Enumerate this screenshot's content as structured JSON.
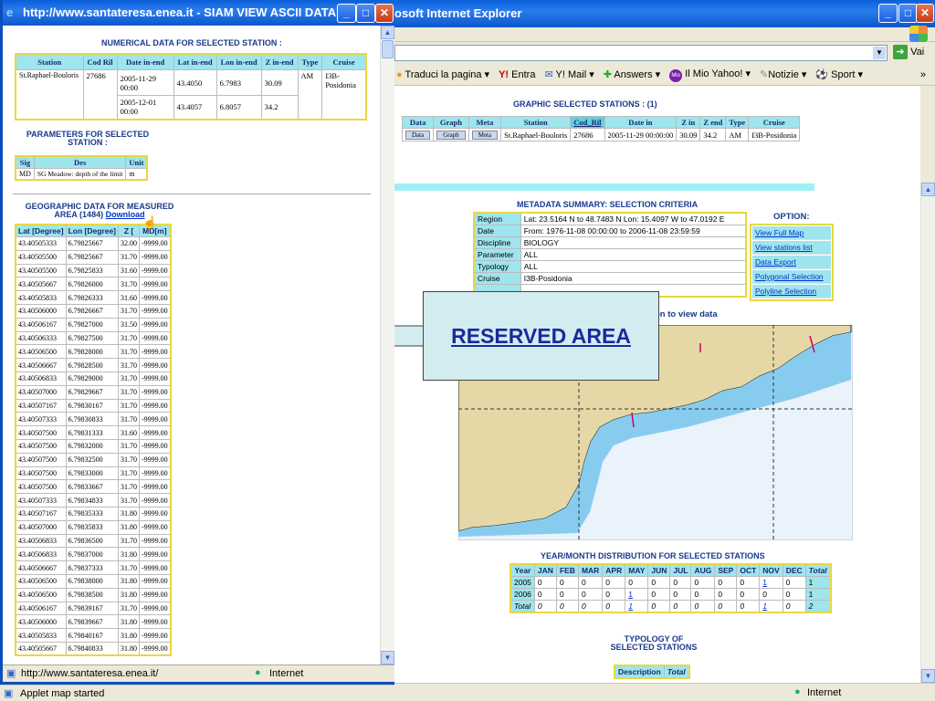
{
  "back_window": {
    "title": "osoft Internet Explorer",
    "address_go": "Vai",
    "links": [
      {
        "icon": "translate-icon",
        "label": "Traduci la pagina"
      },
      {
        "icon": "yahoo-icon",
        "label": "Entra"
      },
      {
        "icon": "mail-icon",
        "label": "Y! Mail"
      },
      {
        "icon": "answers-icon",
        "label": "Answers"
      },
      {
        "icon": "myyahoo-icon",
        "label": "Il Mio Yahoo!"
      },
      {
        "icon": "news-icon",
        "label": "Notizie"
      },
      {
        "icon": "sport-icon",
        "label": "Sport"
      }
    ],
    "status": "Internet"
  },
  "graphic_selected": {
    "heading": "GRAPHIC SELECTED STATIONS : (1)",
    "headers": [
      "Data",
      "Graph",
      "Meta",
      "Station",
      "Cod_Ril",
      "Date in",
      "Z in",
      "Z end",
      "Type",
      "Cruise"
    ],
    "row": {
      "data": "Data",
      "graph": "Graph",
      "meta": "Meta",
      "station": "St.Raphael-Bouloris",
      "cod": "27686",
      "date_in": "2005-11-29 00:00:00",
      "z_in": "30.09",
      "z_end": "34.2",
      "type": "AM",
      "cruise": "I3B-Posidonia"
    }
  },
  "metadata": {
    "heading": "METADATA SUMMARY: SELECTION CRITERIA",
    "rows": [
      {
        "k": "Region",
        "v": "Lat: 23.5164 N to 48.7483 N Lon: 15.4097 W to 47.0192 E"
      },
      {
        "k": "Date",
        "v": "From: 1976-11-08 00:00:00 to 2006-11-08 23:59:59"
      },
      {
        "k": "Discipline",
        "v": "BIOLOGY"
      },
      {
        "k": "Parameter",
        "v": "ALL"
      },
      {
        "k": "Typology",
        "v": "ALL"
      },
      {
        "k": "Cruise",
        "v": "I3B-Posidonia"
      }
    ],
    "option_heading": "OPTION:",
    "options": [
      "View Full Map",
      "View stations list",
      "Data Export",
      "Polygonal Selection",
      "Polyline Selection"
    ],
    "map_caption": "on to view data"
  },
  "year_month": {
    "heading": "YEAR/MONTH DISTRIBUTION FOR SELECTED STATIONS",
    "headers": [
      "Year",
      "JAN",
      "FEB",
      "MAR",
      "APR",
      "MAY",
      "JUN",
      "JUL",
      "AUG",
      "SEP",
      "OCT",
      "NOV",
      "DEC",
      "Total"
    ],
    "rows": [
      [
        "2005",
        "0",
        "0",
        "0",
        "0",
        "0",
        "0",
        "0",
        "0",
        "0",
        "0",
        "1",
        "0",
        "1"
      ],
      [
        "2006",
        "0",
        "0",
        "0",
        "0",
        "1",
        "0",
        "0",
        "0",
        "0",
        "0",
        "0",
        "0",
        "1"
      ],
      [
        "Total",
        "0",
        "0",
        "0",
        "0",
        "1",
        "0",
        "0",
        "0",
        "0",
        "0",
        "1",
        "0",
        "2"
      ]
    ]
  },
  "typology": {
    "heading": "TYPOLOGY OF SELECTED STATIONS",
    "headers": [
      "Description",
      "Total"
    ]
  },
  "reserved_label": "RESERVED AREA",
  "popup": {
    "title": "http://www.santateresa.enea.it - SIAM VIEW ASCII DATA - Mi...",
    "numerical_heading": "NUMERICAL DATA FOR SELECTED STATION :",
    "numerical_headers": [
      "Station",
      "Cod Ril",
      "Date in-end",
      "Lat in-end",
      "Lon in-end",
      "Z in-end",
      "Type",
      "Cruise"
    ],
    "numerical_rows": [
      {
        "station": "St.Raphael-Bouloris",
        "cod": "27686",
        "date": "2005-11-29 00:00",
        "lat": "43.4050",
        "lon": "6.7983",
        "z": "30.09",
        "type": "AM",
        "cruise": "I3B-Posidonia"
      },
      {
        "date": "2005-12-01 00:00",
        "lat": "43.4057",
        "lon": "6.8057",
        "z": "34.2"
      }
    ],
    "params_heading": "PARAMETERS FOR SELECTED STATION :",
    "params_headers": [
      "Sig",
      "Des",
      "Unit"
    ],
    "params_row": [
      "MD",
      "SG Meadow: depth of the limit",
      "m"
    ],
    "geo_heading": "GEOGRAPHIC DATA FOR MEASURED AREA (1484)",
    "geo_download": "Download",
    "geo_headers": [
      "Lat [Degree]",
      "Lon [Degree]",
      "Z [",
      "MD[m]"
    ],
    "geo_rows": [
      [
        "43.40505333",
        "6.79825667",
        "32.00",
        "-9999.00"
      ],
      [
        "43.40505500",
        "6.79825667",
        "31.70",
        "-9999.00"
      ],
      [
        "43.40505500",
        "6.79825833",
        "31.60",
        "-9999.00"
      ],
      [
        "43.40505667",
        "6.79826000",
        "31.70",
        "-9999.00"
      ],
      [
        "43.40505833",
        "6.79826333",
        "31.60",
        "-9999.00"
      ],
      [
        "43.40506000",
        "6.79826667",
        "31.70",
        "-9999.00"
      ],
      [
        "43.40506167",
        "6.79827000",
        "31.50",
        "-9999.00"
      ],
      [
        "43.40506333",
        "6.79827500",
        "31.70",
        "-9999.00"
      ],
      [
        "43.40506500",
        "6.79828000",
        "31.70",
        "-9999.00"
      ],
      [
        "43.40506667",
        "6.79828500",
        "31.70",
        "-9999.00"
      ],
      [
        "43.40506833",
        "6.79829000",
        "31.70",
        "-9999.00"
      ],
      [
        "43.40507000",
        "6.79829667",
        "31.70",
        "-9999.00"
      ],
      [
        "43.40507167",
        "6.79830167",
        "31.70",
        "-9999.00"
      ],
      [
        "43.40507333",
        "6.79830833",
        "31.70",
        "-9999.00"
      ],
      [
        "43.40507500",
        "6.79831333",
        "31.60",
        "-9999.00"
      ],
      [
        "43.40507500",
        "6.79832000",
        "31.70",
        "-9999.00"
      ],
      [
        "43.40507500",
        "6.79832500",
        "31.70",
        "-9999.00"
      ],
      [
        "43.40507500",
        "6.79833000",
        "31.70",
        "-9999.00"
      ],
      [
        "43.40507500",
        "6.79833667",
        "31.70",
        "-9999.00"
      ],
      [
        "43.40507333",
        "6.79834833",
        "31.70",
        "-9999.00"
      ],
      [
        "43.40507167",
        "6.79835333",
        "31.80",
        "-9999.00"
      ],
      [
        "43.40507000",
        "6.79835833",
        "31.80",
        "-9999.00"
      ],
      [
        "43.40506833",
        "6.79836500",
        "31.70",
        "-9999.00"
      ],
      [
        "43.40506833",
        "6.79837000",
        "31.80",
        "-9999.00"
      ],
      [
        "43.40506667",
        "6.79837333",
        "31.70",
        "-9999.00"
      ],
      [
        "43.40506500",
        "6.79838000",
        "31.80",
        "-9999.00"
      ],
      [
        "43.40506500",
        "6.79838500",
        "31.80",
        "-9999.00"
      ],
      [
        "43.40506167",
        "6.79839167",
        "31.70",
        "-9999.00"
      ],
      [
        "43.40506000",
        "6.79839667",
        "31.80",
        "-9999.00"
      ],
      [
        "43.40505833",
        "6.79840167",
        "31.80",
        "-9999.00"
      ],
      [
        "43.40505667",
        "6.79840833",
        "31.80",
        "-9999.00"
      ]
    ],
    "status_url": "http://www.santateresa.enea.it/",
    "status_zone": "Internet"
  },
  "applet_status": "Applet map started"
}
